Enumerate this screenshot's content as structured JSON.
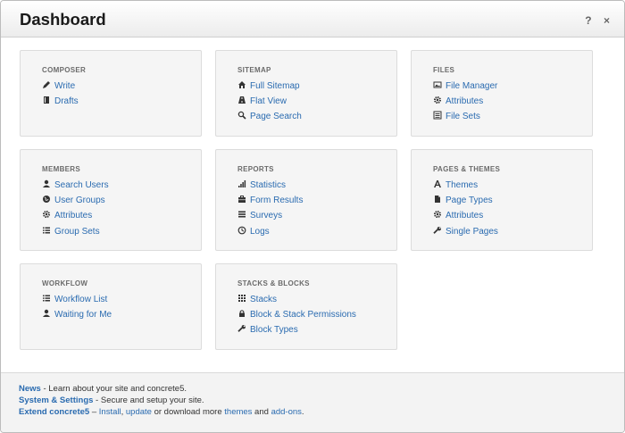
{
  "window": {
    "title": "Dashboard",
    "help": "?",
    "close": "×"
  },
  "cards": [
    {
      "title": "COMPOSER",
      "items": [
        {
          "label": "Write",
          "icon": "pencil-icon"
        },
        {
          "label": "Drafts",
          "icon": "book-icon"
        }
      ]
    },
    {
      "title": "SITEMAP",
      "items": [
        {
          "label": "Full Sitemap",
          "icon": "home-icon"
        },
        {
          "label": "Flat View",
          "icon": "road-icon"
        },
        {
          "label": "Page Search",
          "icon": "search-icon"
        }
      ]
    },
    {
      "title": "FILES",
      "items": [
        {
          "label": "File Manager",
          "icon": "picture-icon"
        },
        {
          "label": "Attributes",
          "icon": "cog-icon"
        },
        {
          "label": "File Sets",
          "icon": "list-alt-icon"
        }
      ]
    },
    {
      "title": "MEMBERS",
      "items": [
        {
          "label": "Search Users",
          "icon": "user-icon"
        },
        {
          "label": "User Groups",
          "icon": "globe-icon"
        },
        {
          "label": "Attributes",
          "icon": "cog-icon"
        },
        {
          "label": "Group Sets",
          "icon": "list-icon"
        }
      ]
    },
    {
      "title": "REPORTS",
      "items": [
        {
          "label": "Statistics",
          "icon": "signal-icon"
        },
        {
          "label": "Form Results",
          "icon": "briefcase-icon"
        },
        {
          "label": "Surveys",
          "icon": "tasks-icon"
        },
        {
          "label": "Logs",
          "icon": "clock-icon"
        }
      ]
    },
    {
      "title": "PAGES & THEMES",
      "items": [
        {
          "label": "Themes",
          "icon": "font-icon"
        },
        {
          "label": "Page Types",
          "icon": "file-icon"
        },
        {
          "label": "Attributes",
          "icon": "cog-icon"
        },
        {
          "label": "Single Pages",
          "icon": "wrench-icon"
        }
      ]
    },
    {
      "title": "WORKFLOW",
      "items": [
        {
          "label": "Workflow List",
          "icon": "list-icon"
        },
        {
          "label": "Waiting for Me",
          "icon": "user-icon"
        }
      ]
    },
    {
      "title": "STACKS & BLOCKS",
      "items": [
        {
          "label": "Stacks",
          "icon": "th-icon"
        },
        {
          "label": "Block & Stack Permissions",
          "icon": "lock-icon"
        },
        {
          "label": "Block Types",
          "icon": "wrench-icon"
        }
      ]
    }
  ],
  "footer": {
    "news_link": "News",
    "news_text": " - Learn about your site and concrete5.",
    "settings_link": "System & Settings",
    "settings_text": " - Secure and setup your site.",
    "extend_link": "Extend concrete5",
    "extend_dash": " – ",
    "install_link": "Install",
    "comma": ", ",
    "update_link": "update",
    "download_text": " or download more ",
    "themes_link": "themes",
    "and_text": " and ",
    "addons_link": "add-ons",
    "period": "."
  },
  "colors": {
    "link": "#2a6bb0",
    "card_bg": "#f5f5f5",
    "footer_bg": "#f3f3f3"
  }
}
